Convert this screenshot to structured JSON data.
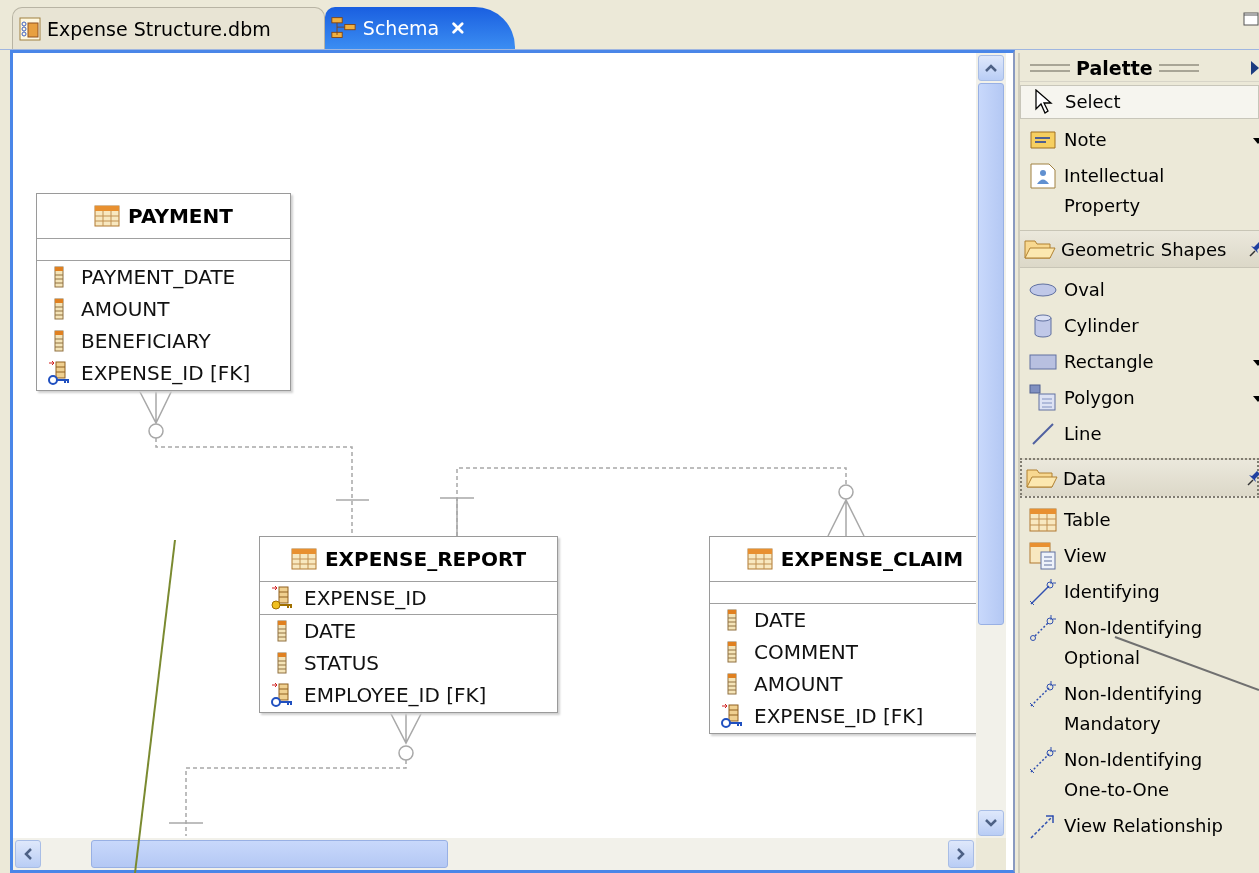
{
  "tabs": [
    {
      "label": "Expense Structure.dbm",
      "selected": false,
      "closable": false
    },
    {
      "label": "Schema",
      "selected": true,
      "closable": true
    }
  ],
  "diagram": {
    "tables": [
      {
        "name": "PAYMENT",
        "columns": [
          {
            "name": "PAYMENT_DATE",
            "kind": "column"
          },
          {
            "name": "AMOUNT",
            "kind": "column"
          },
          {
            "name": "BENEFICIARY",
            "kind": "column"
          },
          {
            "name": "EXPENSE_ID [FK]",
            "kind": "foreign_key"
          }
        ]
      },
      {
        "name": "EXPENSE_REPORT",
        "key_columns": [
          {
            "name": "EXPENSE_ID",
            "kind": "primary_key"
          }
        ],
        "columns": [
          {
            "name": "DATE",
            "kind": "column"
          },
          {
            "name": "STATUS",
            "kind": "column"
          },
          {
            "name": "EMPLOYEE_ID [FK]",
            "kind": "foreign_key"
          }
        ]
      },
      {
        "name": "EXPENSE_CLAIM",
        "columns": [
          {
            "name": "DATE",
            "kind": "column"
          },
          {
            "name": "COMMENT",
            "kind": "column"
          },
          {
            "name": "AMOUNT",
            "kind": "column"
          },
          {
            "name": "EXPENSE_ID [FK]",
            "kind": "foreign_key"
          }
        ]
      }
    ]
  },
  "palette": {
    "title": "Palette",
    "items": [
      {
        "kind": "tool",
        "label": "Select",
        "selected": true,
        "has_menu": false
      },
      {
        "kind": "tool",
        "label": "Note",
        "selected": false,
        "has_menu": true
      },
      {
        "kind": "tool",
        "label": "Intellectual Property",
        "selected": false,
        "has_menu": false
      },
      {
        "kind": "drawer",
        "label": "Geometric Shapes",
        "pinned": true,
        "focused": false
      },
      {
        "kind": "tool",
        "label": "Oval",
        "selected": false,
        "has_menu": false
      },
      {
        "kind": "tool",
        "label": "Cylinder",
        "selected": false,
        "has_menu": false
      },
      {
        "kind": "tool",
        "label": "Rectangle",
        "selected": false,
        "has_menu": true
      },
      {
        "kind": "tool",
        "label": "Polygon",
        "selected": false,
        "has_menu": true
      },
      {
        "kind": "tool",
        "label": "Line",
        "selected": false,
        "has_menu": false
      },
      {
        "kind": "drawer",
        "label": "Data",
        "pinned": true,
        "focused": true
      },
      {
        "kind": "tool",
        "label": "Table",
        "selected": false,
        "has_menu": false
      },
      {
        "kind": "tool",
        "label": "View",
        "selected": false,
        "has_menu": false
      },
      {
        "kind": "tool",
        "label": "Identifying",
        "selected": false,
        "has_menu": false
      },
      {
        "kind": "tool",
        "label": "Non-Identifying Optional",
        "selected": false,
        "has_menu": false
      },
      {
        "kind": "tool",
        "label": "Non-Identifying Mandatory",
        "selected": false,
        "has_menu": false
      },
      {
        "kind": "tool",
        "label": "Non-Identifying One-to-One",
        "selected": false,
        "has_menu": false
      },
      {
        "kind": "tool",
        "label": "View Relationship",
        "selected": false,
        "has_menu": false
      }
    ]
  }
}
